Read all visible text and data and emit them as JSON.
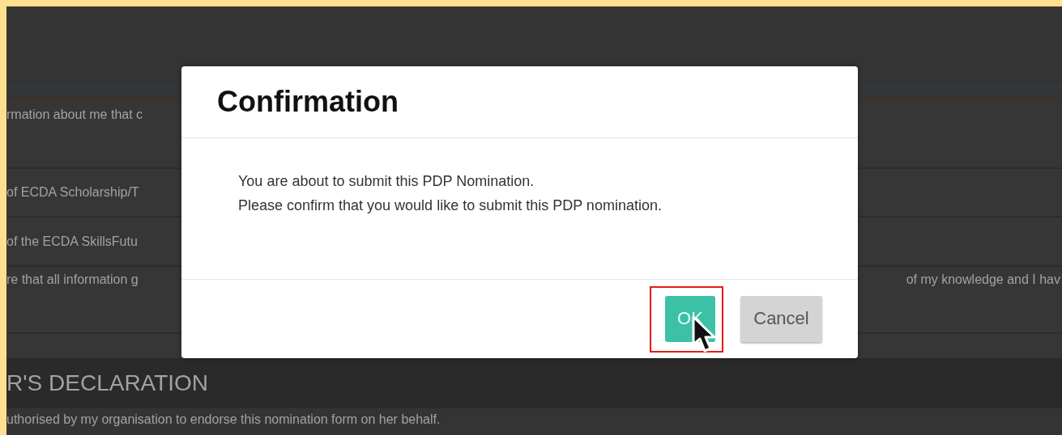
{
  "background": {
    "rows": [
      {
        "text": "rmation about me that c"
      },
      {
        "text": "of ECDA Scholarship/T"
      },
      {
        "text": "of the ECDA SkillsFutu"
      },
      {
        "text": "re that all information g",
        "text_right": "of my knowledge and I hav"
      }
    ],
    "section_title": "R'S DECLARATION",
    "section_text": "uthorised by my organisation to endorse this nomination form on her behalf."
  },
  "dialog": {
    "title": "Confirmation",
    "message": [
      "You are about to submit this PDP Nomination.",
      "Please confirm that you would like to submit this PDP nomination."
    ],
    "buttons": [
      {
        "label": "OK",
        "kind": "primary",
        "highlighted": true
      },
      {
        "label": "Cancel",
        "kind": "secondary",
        "highlighted": false
      }
    ]
  }
}
